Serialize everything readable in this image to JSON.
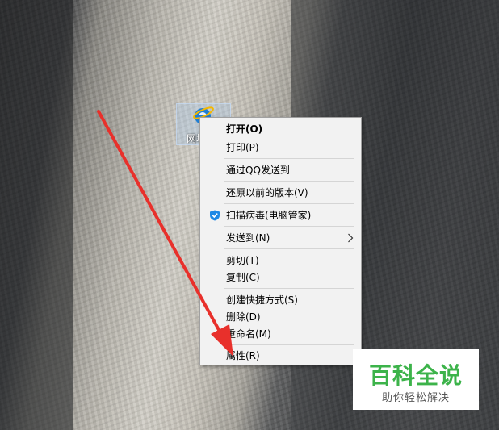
{
  "desktop": {
    "icon_label": "网址"
  },
  "context_menu": {
    "items": [
      {
        "label": "打开(O)",
        "bold": true
      },
      {
        "label": "打印(P)"
      },
      {
        "label": "通过QQ发送到"
      },
      {
        "label": "还原以前的版本(V)"
      },
      {
        "label": "扫描病毒(电脑管家)",
        "icon": "shield-icon"
      },
      {
        "label": "发送到(N)",
        "submenu": true
      },
      {
        "label": "剪切(T)"
      },
      {
        "label": "复制(C)"
      },
      {
        "label": "创建快捷方式(S)"
      },
      {
        "label": "删除(D)"
      },
      {
        "label": "重命名(M)"
      },
      {
        "label": "属性(R)"
      }
    ]
  },
  "watermark": {
    "title": "百科全说",
    "subtitle": "助你轻松解决"
  },
  "colors": {
    "menu_bg": "#f2f2f2",
    "arrow": "#e8302b",
    "shield": "#1e88e5",
    "watermark_green": "#3cb34a"
  }
}
